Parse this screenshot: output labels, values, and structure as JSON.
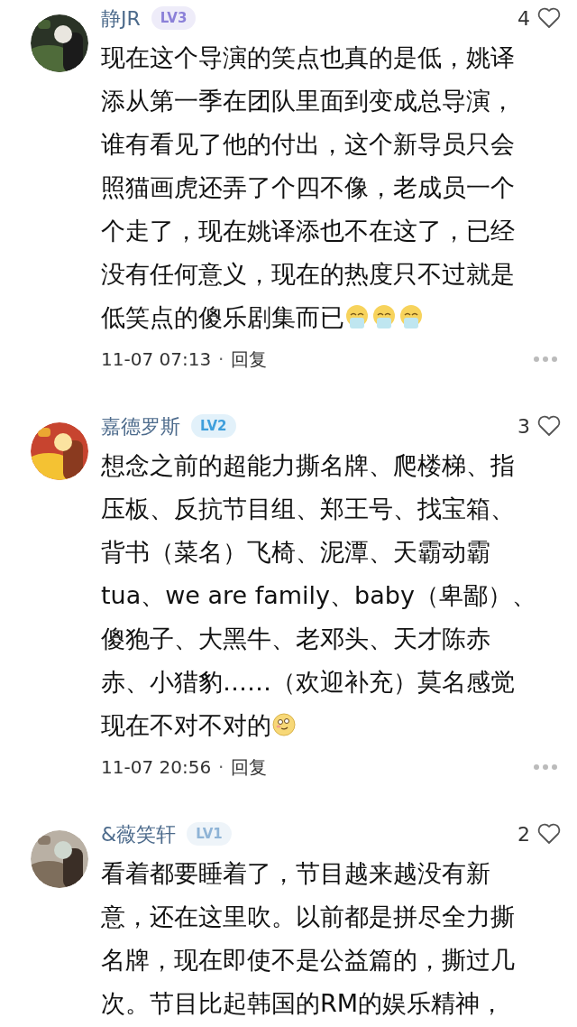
{
  "comments": [
    {
      "avatar": {
        "kind": "picture"
      },
      "name": "静JR",
      "badge": {
        "text": "LV3",
        "color": "#8b80d8"
      },
      "likes": "4",
      "lines": [
        "现在这个导演的笑点也真的是低，姚译",
        "添从第一季在团队里面到变成总导演，",
        "谁有看见了他的付出，这个新导员只会",
        "照猫画虎还弄了个四不像，老成员一个",
        "个走了，现在姚译添也不在这了，已经",
        "没有任何意义，现在的热度只不过就是",
        "低笑点的傻乐剧集而已"
      ],
      "emojis": [
        {
          "kind": "crying"
        },
        {
          "kind": "crying"
        },
        {
          "kind": "crying"
        }
      ],
      "time": "11-07 07:13",
      "separator": "·",
      "reply": "回复"
    },
    {
      "avatar": {
        "kind": "picture"
      },
      "name": "嘉德罗斯",
      "badge": {
        "text": "LV2",
        "color": "#3f9fdc"
      },
      "likes": "3",
      "lines": [
        "想念之前的超能力撕名牌、爬楼梯、指",
        "压板、反抗节目组、郑王号、找宝箱、",
        "背书（菜名）飞椅、泥潭、天霸动霸",
        "tua、we are family、baby（卑鄙）、",
        "傻狍子、大黑牛、老邓头、天才陈赤",
        "赤、小猎豹……（欢迎补充）莫名感觉",
        "现在不对不对的"
      ],
      "emojis": [
        {
          "kind": "shy"
        }
      ],
      "time": "11-07 20:56",
      "separator": "·",
      "reply": "回复"
    },
    {
      "avatar": {
        "kind": "picture"
      },
      "name": "&薇笑轩",
      "badge": {
        "text": "LV1",
        "color": "#8fb4d6"
      },
      "likes": "2",
      "lines": [
        "看着都要睡着了，节目越来越没有新",
        "意，还在这里吹。以前都是拼尽全力撕",
        "名牌，现在即使不是公益篇的，撕过几",
        "次。节目比起韩国的RM的娱乐精神，"
      ]
    }
  ]
}
